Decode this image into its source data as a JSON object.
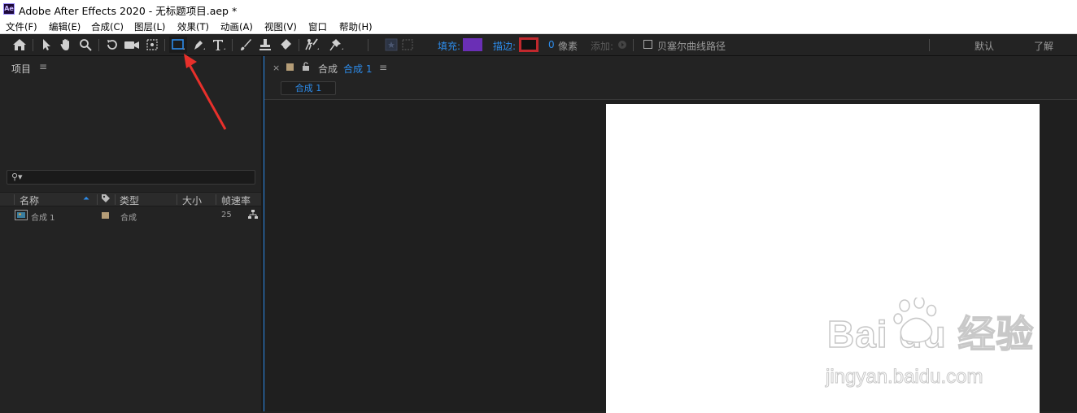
{
  "window": {
    "app_icon": "Ae",
    "title": "Adobe After Effects 2020 - 无标题项目.aep *"
  },
  "menu": [
    "文件(F)",
    "编辑(E)",
    "合成(C)",
    "图层(L)",
    "效果(T)",
    "动画(A)",
    "视图(V)",
    "窗口",
    "帮助(H)"
  ],
  "toolbar": {
    "tools": [
      "home-icon",
      "selection-tool-icon",
      "hand-tool-icon",
      "zoom-tool-icon",
      "rotate-tool-icon",
      "camera-tool-icon",
      "pan-behind-tool-icon",
      "rectangle-tool-icon",
      "pen-tool-icon",
      "type-tool-icon",
      "brush-tool-icon",
      "clone-stamp-tool-icon",
      "eraser-tool-icon",
      "roto-brush-tool-icon",
      "puppet-pin-tool-icon"
    ],
    "fill_label": "填充:",
    "fill_color": "#6a2fb5",
    "stroke_label": "描边:",
    "stroke_color": "#c0282d",
    "stroke_width": "0",
    "stroke_unit": "像素",
    "add_label": "添加:",
    "bezier_label": "贝塞尔曲线路径",
    "workspace_default": "默认",
    "workspace_learn": "了解"
  },
  "project_panel": {
    "title": "项目",
    "columns": [
      "名称",
      "类型",
      "大小",
      "帧速率"
    ],
    "items": [
      {
        "name": "合成 1",
        "type": "合成",
        "size": "",
        "fps": "25",
        "label_color": "#b59d77"
      }
    ]
  },
  "comp_panel": {
    "close": "×",
    "tab_prefix": "合成",
    "tab_name": "合成 1",
    "breadcrumb": "合成 1",
    "label_color": "#b59d77"
  },
  "watermark": {
    "logo_text": "Bai  du 经验",
    "url": "jingyan.baidu.com"
  },
  "colors": {
    "accent_blue": "#2d8ceb",
    "panel_bg": "#232323",
    "annotation_red": "#e8302b"
  }
}
